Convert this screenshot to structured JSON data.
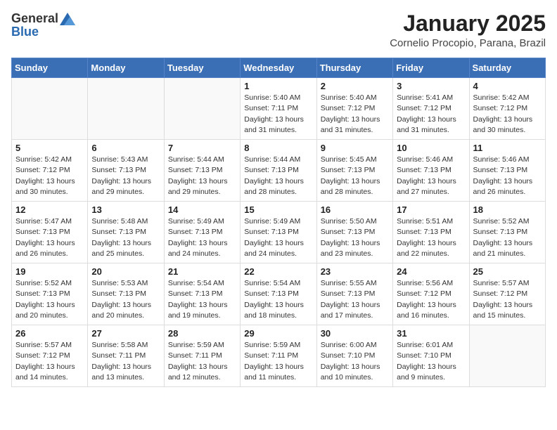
{
  "header": {
    "logo_general": "General",
    "logo_blue": "Blue",
    "month_title": "January 2025",
    "location": "Cornelio Procopio, Parana, Brazil"
  },
  "weekdays": [
    "Sunday",
    "Monday",
    "Tuesday",
    "Wednesday",
    "Thursday",
    "Friday",
    "Saturday"
  ],
  "weeks": [
    [
      {
        "day": "",
        "info": ""
      },
      {
        "day": "",
        "info": ""
      },
      {
        "day": "",
        "info": ""
      },
      {
        "day": "1",
        "info": "Sunrise: 5:40 AM\nSunset: 7:11 PM\nDaylight: 13 hours\nand 31 minutes."
      },
      {
        "day": "2",
        "info": "Sunrise: 5:40 AM\nSunset: 7:12 PM\nDaylight: 13 hours\nand 31 minutes."
      },
      {
        "day": "3",
        "info": "Sunrise: 5:41 AM\nSunset: 7:12 PM\nDaylight: 13 hours\nand 31 minutes."
      },
      {
        "day": "4",
        "info": "Sunrise: 5:42 AM\nSunset: 7:12 PM\nDaylight: 13 hours\nand 30 minutes."
      }
    ],
    [
      {
        "day": "5",
        "info": "Sunrise: 5:42 AM\nSunset: 7:12 PM\nDaylight: 13 hours\nand 30 minutes."
      },
      {
        "day": "6",
        "info": "Sunrise: 5:43 AM\nSunset: 7:13 PM\nDaylight: 13 hours\nand 29 minutes."
      },
      {
        "day": "7",
        "info": "Sunrise: 5:44 AM\nSunset: 7:13 PM\nDaylight: 13 hours\nand 29 minutes."
      },
      {
        "day": "8",
        "info": "Sunrise: 5:44 AM\nSunset: 7:13 PM\nDaylight: 13 hours\nand 28 minutes."
      },
      {
        "day": "9",
        "info": "Sunrise: 5:45 AM\nSunset: 7:13 PM\nDaylight: 13 hours\nand 28 minutes."
      },
      {
        "day": "10",
        "info": "Sunrise: 5:46 AM\nSunset: 7:13 PM\nDaylight: 13 hours\nand 27 minutes."
      },
      {
        "day": "11",
        "info": "Sunrise: 5:46 AM\nSunset: 7:13 PM\nDaylight: 13 hours\nand 26 minutes."
      }
    ],
    [
      {
        "day": "12",
        "info": "Sunrise: 5:47 AM\nSunset: 7:13 PM\nDaylight: 13 hours\nand 26 minutes."
      },
      {
        "day": "13",
        "info": "Sunrise: 5:48 AM\nSunset: 7:13 PM\nDaylight: 13 hours\nand 25 minutes."
      },
      {
        "day": "14",
        "info": "Sunrise: 5:49 AM\nSunset: 7:13 PM\nDaylight: 13 hours\nand 24 minutes."
      },
      {
        "day": "15",
        "info": "Sunrise: 5:49 AM\nSunset: 7:13 PM\nDaylight: 13 hours\nand 24 minutes."
      },
      {
        "day": "16",
        "info": "Sunrise: 5:50 AM\nSunset: 7:13 PM\nDaylight: 13 hours\nand 23 minutes."
      },
      {
        "day": "17",
        "info": "Sunrise: 5:51 AM\nSunset: 7:13 PM\nDaylight: 13 hours\nand 22 minutes."
      },
      {
        "day": "18",
        "info": "Sunrise: 5:52 AM\nSunset: 7:13 PM\nDaylight: 13 hours\nand 21 minutes."
      }
    ],
    [
      {
        "day": "19",
        "info": "Sunrise: 5:52 AM\nSunset: 7:13 PM\nDaylight: 13 hours\nand 20 minutes."
      },
      {
        "day": "20",
        "info": "Sunrise: 5:53 AM\nSunset: 7:13 PM\nDaylight: 13 hours\nand 20 minutes."
      },
      {
        "day": "21",
        "info": "Sunrise: 5:54 AM\nSunset: 7:13 PM\nDaylight: 13 hours\nand 19 minutes."
      },
      {
        "day": "22",
        "info": "Sunrise: 5:54 AM\nSunset: 7:13 PM\nDaylight: 13 hours\nand 18 minutes."
      },
      {
        "day": "23",
        "info": "Sunrise: 5:55 AM\nSunset: 7:13 PM\nDaylight: 13 hours\nand 17 minutes."
      },
      {
        "day": "24",
        "info": "Sunrise: 5:56 AM\nSunset: 7:12 PM\nDaylight: 13 hours\nand 16 minutes."
      },
      {
        "day": "25",
        "info": "Sunrise: 5:57 AM\nSunset: 7:12 PM\nDaylight: 13 hours\nand 15 minutes."
      }
    ],
    [
      {
        "day": "26",
        "info": "Sunrise: 5:57 AM\nSunset: 7:12 PM\nDaylight: 13 hours\nand 14 minutes."
      },
      {
        "day": "27",
        "info": "Sunrise: 5:58 AM\nSunset: 7:11 PM\nDaylight: 13 hours\nand 13 minutes."
      },
      {
        "day": "28",
        "info": "Sunrise: 5:59 AM\nSunset: 7:11 PM\nDaylight: 13 hours\nand 12 minutes."
      },
      {
        "day": "29",
        "info": "Sunrise: 5:59 AM\nSunset: 7:11 PM\nDaylight: 13 hours\nand 11 minutes."
      },
      {
        "day": "30",
        "info": "Sunrise: 6:00 AM\nSunset: 7:10 PM\nDaylight: 13 hours\nand 10 minutes."
      },
      {
        "day": "31",
        "info": "Sunrise: 6:01 AM\nSunset: 7:10 PM\nDaylight: 13 hours\nand 9 minutes."
      },
      {
        "day": "",
        "info": ""
      }
    ]
  ]
}
